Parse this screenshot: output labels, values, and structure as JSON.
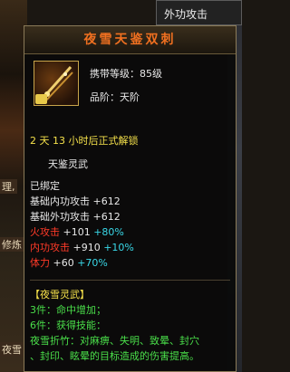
{
  "top_tab": "外功攻击",
  "side_labels": [
    "理,",
    "修炼",
    "夜雪"
  ],
  "item": {
    "name": "夜雪天鉴双刺",
    "carry_level": "携带等级：85级",
    "grade": "品阶：天阶",
    "unlock_time": "2 天 13 小时后正式解锁",
    "spirit": "天鉴灵武",
    "bound": "已绑定",
    "stats": [
      {
        "label": "基础内功攻击",
        "value": "+612"
      },
      {
        "label": "基础外功攻击",
        "value": "+612"
      }
    ],
    "bonuses": [
      {
        "label": "火攻击",
        "value": "+101",
        "pct": "+80%"
      },
      {
        "label": "内功攻击",
        "value": "+910",
        "pct": "+10%"
      },
      {
        "label": "体力",
        "value": "+60",
        "pct": "+70%"
      }
    ],
    "set_name": "【夜雪灵武】",
    "set_3": "3件：命中增加；",
    "set_6": "6件：获得技能：",
    "skill_line1": "夜雪折竹：对麻痹、失明、致晕、封穴",
    "skill_line2": "、封印、眩晕的目标造成的伤害提高。"
  },
  "colors": {
    "title": "#f07020",
    "yellow": "#f4e04a",
    "red": "#ff3a28",
    "green": "#4adf4a",
    "cyan": "#39d8e8"
  }
}
